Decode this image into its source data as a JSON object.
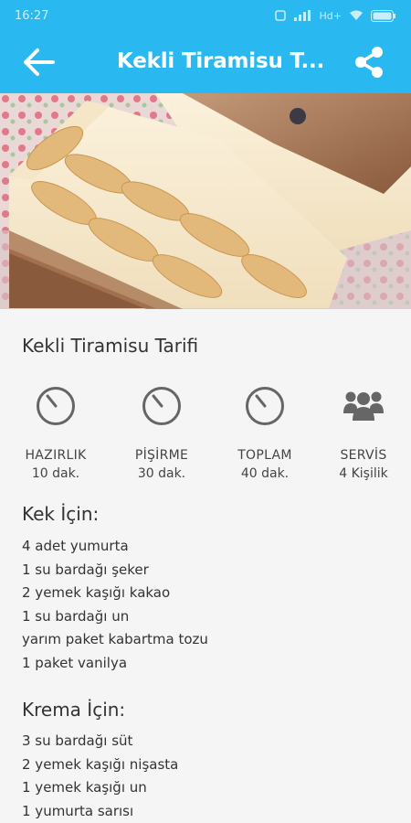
{
  "status_bar": {
    "time": "16:27",
    "network": "Hd+"
  },
  "colors": {
    "app_bar": "#29b9f0",
    "icon_gray": "#666666"
  },
  "app_bar": {
    "title": "Kekli Tiramisu T...",
    "back_icon": "arrow-left-icon",
    "share_icon": "share-icon"
  },
  "recipe": {
    "title": "Kekli Tiramisu Tarifi",
    "stats": [
      {
        "icon": "timer-icon",
        "label": "HAZIRLIK",
        "value": "10 dak."
      },
      {
        "icon": "timer-icon",
        "label": "PİŞİRME",
        "value": "30 dak."
      },
      {
        "icon": "timer-icon",
        "label": "TOPLAM",
        "value": "40 dak."
      },
      {
        "icon": "people-icon",
        "label": "SERVİS",
        "value": "4 Kişilik"
      }
    ],
    "sections": [
      {
        "title": "Kek İçin:",
        "items": [
          "4 adet yumurta",
          "1 su bardağı şeker",
          "2 yemek kaşığı kakao",
          "1 su bardağı un",
          "yarım paket kabartma tozu",
          "1 paket vanilya"
        ]
      },
      {
        "title": "Krema İçin:",
        "items": [
          "3 su bardağı süt",
          "2 yemek kaşığı nişasta",
          "1 yemek kaşığı un",
          "1 yumurta sarısı"
        ]
      }
    ]
  }
}
